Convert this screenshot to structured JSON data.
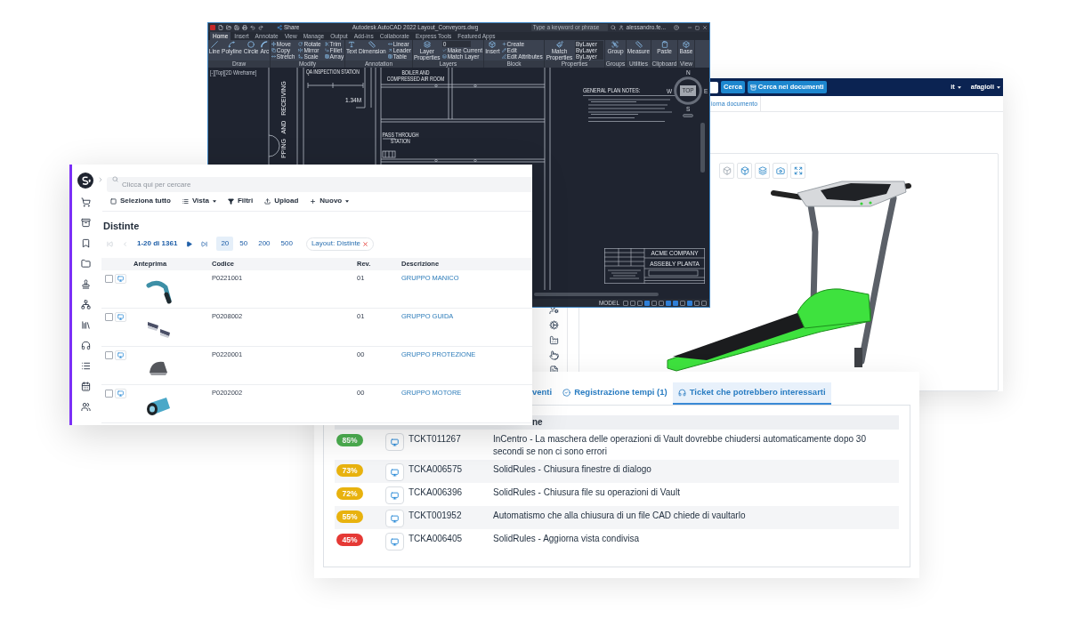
{
  "cad_window": {
    "title": "Autodesk AutoCAD 2022 Layout_Conveyors.dwg",
    "share_button": "Share",
    "search": {
      "placeholder": "Type a keyword or phrase"
    },
    "user": "alessandro.fe...",
    "ribbon_tabs": [
      {
        "label": "Home",
        "selected": true
      },
      {
        "label": "Insert",
        "selected": false
      },
      {
        "label": "Annotate",
        "selected": false
      },
      {
        "label": "View",
        "selected": false
      },
      {
        "label": "Manage",
        "selected": false
      },
      {
        "label": "Output",
        "selected": false
      },
      {
        "label": "Add-ins",
        "selected": false
      },
      {
        "label": "Collaborate",
        "selected": false
      },
      {
        "label": "Express Tools",
        "selected": false
      },
      {
        "label": "Featured Apps",
        "selected": false
      }
    ],
    "ribbon_panels": [
      {
        "title": "Draw",
        "tools": [
          {
            "label": "Line",
            "kind": "large"
          },
          {
            "label": "Polyline",
            "kind": "large"
          },
          {
            "label": "Circle",
            "kind": "large"
          },
          {
            "label": "Arc",
            "kind": "large"
          }
        ]
      },
      {
        "title": "Modify",
        "tools": [
          {
            "label": "Move",
            "kind": "small"
          },
          {
            "label": "Copy",
            "kind": "small"
          },
          {
            "label": "Stretch",
            "kind": "small"
          },
          {
            "label": "Rotate",
            "kind": "small"
          },
          {
            "label": "Mirror",
            "kind": "small"
          },
          {
            "label": "Scale",
            "kind": "small"
          },
          {
            "label": "Trim",
            "kind": "small"
          },
          {
            "label": "Fillet",
            "kind": "small"
          },
          {
            "label": "Array",
            "kind": "small"
          }
        ]
      },
      {
        "title": "Annotation",
        "tools": [
          {
            "label": "Text",
            "kind": "large"
          },
          {
            "label": "Dimension",
            "kind": "large"
          },
          {
            "label": "Linear",
            "kind": "small"
          },
          {
            "label": "Leader",
            "kind": "small"
          },
          {
            "label": "Table",
            "kind": "small"
          }
        ]
      },
      {
        "title": "Layers",
        "tools": [
          {
            "label": "Layer Properties",
            "kind": "large"
          },
          {
            "label": "0",
            "kind": "dropdown"
          },
          {
            "label": "Make Current",
            "kind": "small"
          },
          {
            "label": "Match Layer",
            "kind": "small"
          }
        ]
      },
      {
        "title": "Block",
        "tools": [
          {
            "label": "Insert",
            "kind": "large"
          },
          {
            "label": "Create",
            "kind": "small"
          },
          {
            "label": "Edit",
            "kind": "small"
          },
          {
            "label": "Edit Attributes",
            "kind": "small"
          }
        ]
      },
      {
        "title": "Properties",
        "tools": [
          {
            "label": "Match Properties",
            "kind": "large"
          },
          {
            "label": "ByLayer",
            "kind": "dropdown"
          },
          {
            "label": "ByLayer",
            "kind": "dropdown"
          },
          {
            "label": "ByLayer",
            "kind": "dropdown"
          }
        ]
      },
      {
        "title": "Groups",
        "tools": [
          {
            "label": "Group",
            "kind": "large"
          }
        ]
      },
      {
        "title": "Utilities",
        "tools": [
          {
            "label": "Measure",
            "kind": "large"
          }
        ]
      },
      {
        "title": "Clipboard",
        "tools": [
          {
            "label": "Paste",
            "kind": "large"
          }
        ]
      },
      {
        "title": "View",
        "tools": [
          {
            "label": "Base",
            "kind": "large"
          }
        ]
      }
    ],
    "viewport_label": "[-][Top][2D Wireframe]",
    "plan": {
      "qa_station": "QA INSPECTION STATION",
      "boiler_room": [
        "BOILER AND",
        "COMPRESSED AIR ROOM"
      ],
      "shipping_area": "PPING AND RECEIVING",
      "pass_through": [
        "PASS THROUGH",
        "STATION"
      ],
      "dimension": "1.34M"
    },
    "notes_title": "GENERAL PLAN NOTES:",
    "compass": {
      "north": "N",
      "south": "S",
      "east": "E",
      "west": "W",
      "face": "TOP"
    },
    "title_block": {
      "company": "ACME COMPANY",
      "drawing": "ASSEBLY PLANTA"
    },
    "status_bar": {
      "mode": "MODEL",
      "toggles": [
        {
          "on": false
        },
        {
          "on": false
        },
        {
          "on": false
        },
        {
          "on": true
        },
        {
          "on": false
        },
        {
          "on": false
        },
        {
          "on": true
        },
        {
          "on": true
        },
        {
          "on": false
        },
        {
          "on": true
        },
        {
          "on": false
        },
        {
          "on": false
        }
      ]
    }
  },
  "document_viewer": {
    "nav": {
      "search_button": "Cerca",
      "documents_search_button": "Cerca nei documenti",
      "language": "it",
      "user": "afagioli"
    },
    "tab": "iorna documento"
  },
  "parts_list": {
    "search": {
      "placeholder": "Clicca qui per cercare"
    },
    "toolbar": [
      {
        "label": "Seleziona tutto",
        "kind": "select",
        "dropdown": false
      },
      {
        "label": "Vista",
        "kind": "view",
        "dropdown": true
      },
      {
        "label": "Filtri",
        "kind": "filter",
        "dropdown": false
      },
      {
        "label": "Upload",
        "kind": "upload",
        "dropdown": false
      },
      {
        "label": "Nuovo",
        "kind": "new",
        "dropdown": true
      }
    ],
    "title": "Distinte",
    "pagination": {
      "nav_before": [
        {
          "kind": "first",
          "disabled": true
        },
        {
          "kind": "previous",
          "disabled": true
        }
      ],
      "range": "1-20 di 1361",
      "nav_after": [
        {
          "kind": "next",
          "disabled": false
        },
        {
          "kind": "last",
          "disabled": false
        }
      ],
      "page_sizes": [
        {
          "label": "20",
          "selected": true
        },
        {
          "label": "50",
          "selected": false
        },
        {
          "label": "200",
          "selected": false
        },
        {
          "label": "500",
          "selected": false
        }
      ],
      "layout_chip": "Layout: Distinte"
    },
    "columns": [
      "Anteprima",
      "Codice",
      "Rev.",
      "Descrizione"
    ],
    "rows": [
      {
        "checked": false,
        "code": "P0221001",
        "rev": "01",
        "description": "GRUPPO MANICO"
      },
      {
        "checked": false,
        "code": "P0208002",
        "rev": "01",
        "description": "GRUPPO GUIDA"
      },
      {
        "checked": false,
        "code": "P0220001",
        "rev": "00",
        "description": "GRUPPO PROTEZIONE"
      },
      {
        "checked": false,
        "code": "P0202002",
        "rev": "00",
        "description": "GRUPPO MOTORE"
      }
    ]
  },
  "tickets": {
    "tabs": [
      {
        "label": "venti",
        "kind": "events",
        "selected": false
      },
      {
        "label": "Registrazione tempi (1)",
        "kind": "time",
        "selected": false
      },
      {
        "label": "Ticket che potrebbero interessarti",
        "kind": "tickets",
        "selected": true
      }
    ],
    "header": "ne",
    "rows": [
      {
        "score": "85%",
        "color": "#4caf50",
        "code": "TCKT011267",
        "description": "InCentro - La maschera delle operazioni di Vault dovrebbe chiudersi automaticamente dopo 30 secondi se non ci sono errori"
      },
      {
        "score": "73%",
        "color": "#e8b20e",
        "code": "TCKA006575",
        "description": "SolidRules - Chiusura finestre di dialogo"
      },
      {
        "score": "72%",
        "color": "#e8b20e",
        "code": "TCKA006396",
        "description": "SolidRules - Chiusura file su operazioni di Vault"
      },
      {
        "score": "55%",
        "color": "#e8b20e",
        "code": "TCKT001952",
        "description": "Automatismo che alla chiusura di un file CAD chiede di vaultarlo"
      },
      {
        "score": "45%",
        "color": "#e53935",
        "code": "TCKA006405",
        "description": "SolidRules - Aggiorna vista condivisa"
      }
    ]
  }
}
